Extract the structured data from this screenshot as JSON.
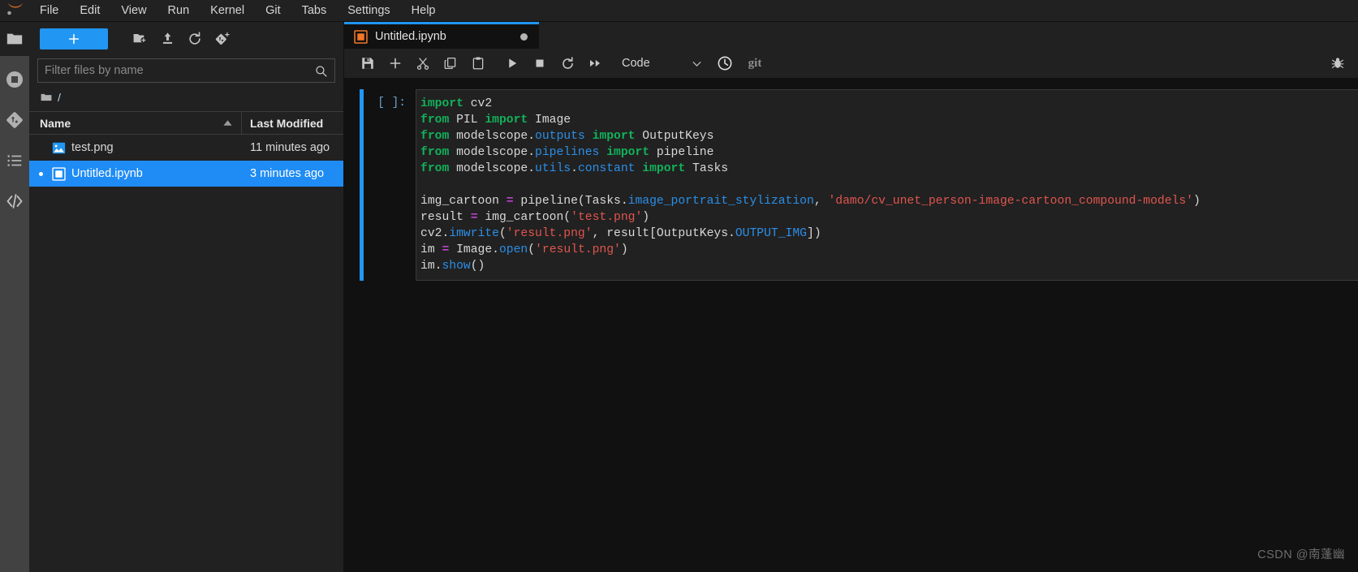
{
  "app": {
    "logo": "jupyter-logo",
    "watermark": "CSDN @南蓬幽"
  },
  "menubar": {
    "items": [
      {
        "label": "File",
        "name": "menu-file"
      },
      {
        "label": "Edit",
        "name": "menu-edit"
      },
      {
        "label": "View",
        "name": "menu-view"
      },
      {
        "label": "Run",
        "name": "menu-run"
      },
      {
        "label": "Kernel",
        "name": "menu-kernel"
      },
      {
        "label": "Git",
        "name": "menu-git"
      },
      {
        "label": "Tabs",
        "name": "menu-tabs"
      },
      {
        "label": "Settings",
        "name": "menu-settings"
      },
      {
        "label": "Help",
        "name": "menu-help"
      }
    ]
  },
  "activitybar": {
    "items": [
      {
        "icon": "folder-icon",
        "name": "sidebar-file-browser",
        "active": true
      },
      {
        "icon": "running-terminals-icon",
        "name": "sidebar-running-sessions",
        "active": false
      },
      {
        "icon": "git-icon",
        "name": "sidebar-git",
        "active": false
      },
      {
        "icon": "table-of-contents-icon",
        "name": "sidebar-table-of-contents",
        "active": false
      },
      {
        "icon": "extension-code-icon",
        "name": "sidebar-extension-manager",
        "active": false
      }
    ]
  },
  "filebrowser": {
    "new_button_label": "+",
    "toolbar": [
      {
        "icon": "new-folder-icon",
        "name": "new-folder-button"
      },
      {
        "icon": "upload-icon",
        "name": "upload-files-button"
      },
      {
        "icon": "refresh-icon",
        "name": "refresh-file-list-button"
      },
      {
        "icon": "new-git-repo-icon",
        "name": "git-clone-button"
      }
    ],
    "filter": {
      "placeholder": "Filter files by name",
      "value": ""
    },
    "breadcrumb": "/",
    "columns": {
      "name": "Name",
      "last_modified": "Last Modified",
      "sort_direction": "ascending"
    },
    "rows": [
      {
        "name": "test.png",
        "last_modified": "11 minutes ago",
        "icon": "image-file-icon",
        "selected": false,
        "running": false
      },
      {
        "name": "Untitled.ipynb",
        "last_modified": "3 minutes ago",
        "icon": "notebook-file-icon",
        "selected": true,
        "running": true
      }
    ]
  },
  "main": {
    "tabs": [
      {
        "label": "Untitled.ipynb",
        "icon": "notebook-icon",
        "dirty": true,
        "active": true
      }
    ],
    "notebook_toolbar": {
      "buttons": [
        {
          "icon": "save-icon",
          "name": "save-notebook-button"
        },
        {
          "icon": "add-cell-icon",
          "name": "insert-cell-button"
        },
        {
          "icon": "cut-icon",
          "name": "cut-cell-button"
        },
        {
          "icon": "copy-icon",
          "name": "copy-cell-button"
        },
        {
          "icon": "paste-icon",
          "name": "paste-cell-button"
        },
        {
          "icon": "run-icon",
          "name": "run-cell-button"
        },
        {
          "icon": "stop-icon",
          "name": "interrupt-kernel-button"
        },
        {
          "icon": "restart-icon",
          "name": "restart-kernel-button"
        },
        {
          "icon": "fast-forward-icon",
          "name": "restart-and-run-all-button"
        }
      ],
      "cell_type": "Code",
      "cell_type_chevron": "chevron-down-icon",
      "history_icon": "clock-icon",
      "git_label": "git",
      "debugger_icon": "bug-icon"
    },
    "cell": {
      "prompt": "[ ]:",
      "lines": [
        [
          {
            "t": "import",
            "c": "kw"
          },
          {
            "t": " cv2",
            "c": "plain"
          }
        ],
        [
          {
            "t": "from",
            "c": "kw"
          },
          {
            "t": " PIL ",
            "c": "plain"
          },
          {
            "t": "import",
            "c": "kw"
          },
          {
            "t": " Image",
            "c": "plain"
          }
        ],
        [
          {
            "t": "from",
            "c": "kw"
          },
          {
            "t": " modelscope.",
            "c": "plain"
          },
          {
            "t": "outputs",
            "c": "mod"
          },
          {
            "t": " ",
            "c": "plain"
          },
          {
            "t": "import",
            "c": "kw"
          },
          {
            "t": " OutputKeys",
            "c": "plain"
          }
        ],
        [
          {
            "t": "from",
            "c": "kw"
          },
          {
            "t": " modelscope.",
            "c": "plain"
          },
          {
            "t": "pipelines",
            "c": "mod"
          },
          {
            "t": " ",
            "c": "plain"
          },
          {
            "t": "import",
            "c": "kw"
          },
          {
            "t": " pipeline",
            "c": "plain"
          }
        ],
        [
          {
            "t": "from",
            "c": "kw"
          },
          {
            "t": " modelscope.",
            "c": "plain"
          },
          {
            "t": "utils",
            "c": "mod"
          },
          {
            "t": ".",
            "c": "plain"
          },
          {
            "t": "constant",
            "c": "mod"
          },
          {
            "t": " ",
            "c": "plain"
          },
          {
            "t": "import",
            "c": "kw"
          },
          {
            "t": " Tasks",
            "c": "plain"
          }
        ],
        [],
        [
          {
            "t": "img_cartoon ",
            "c": "plain"
          },
          {
            "t": "=",
            "c": "op"
          },
          {
            "t": " pipeline(Tasks.",
            "c": "plain"
          },
          {
            "t": "image_portrait_stylization",
            "c": "mod"
          },
          {
            "t": ", ",
            "c": "plain"
          },
          {
            "t": "'damo/cv_unet_person-image-cartoon_compound-models'",
            "c": "str"
          },
          {
            "t": ")",
            "c": "plain"
          }
        ],
        [
          {
            "t": "result ",
            "c": "plain"
          },
          {
            "t": "=",
            "c": "op"
          },
          {
            "t": " img_cartoon(",
            "c": "plain"
          },
          {
            "t": "'test.png'",
            "c": "str"
          },
          {
            "t": ")",
            "c": "plain"
          }
        ],
        [
          {
            "t": "cv2.",
            "c": "plain"
          },
          {
            "t": "imwrite",
            "c": "fn"
          },
          {
            "t": "(",
            "c": "plain"
          },
          {
            "t": "'result.png'",
            "c": "str"
          },
          {
            "t": ", result[OutputKeys.",
            "c": "plain"
          },
          {
            "t": "OUTPUT_IMG",
            "c": "mod"
          },
          {
            "t": "])",
            "c": "plain"
          }
        ],
        [
          {
            "t": "im ",
            "c": "plain"
          },
          {
            "t": "=",
            "c": "op"
          },
          {
            "t": " Image.",
            "c": "plain"
          },
          {
            "t": "open",
            "c": "fn"
          },
          {
            "t": "(",
            "c": "plain"
          },
          {
            "t": "'result.png'",
            "c": "str"
          },
          {
            "t": ")",
            "c": "plain"
          }
        ],
        [
          {
            "t": "im.",
            "c": "plain"
          },
          {
            "t": "show",
            "c": "fn"
          },
          {
            "t": "()",
            "c": "plain"
          }
        ]
      ]
    }
  },
  "colors": {
    "accent": "#2196f3",
    "selection": "#1f8cf5",
    "panel_bg": "#212121",
    "editor_bg": "#212121",
    "body_bg": "#111111",
    "activitybar_bg": "#424242",
    "keyword": "#13b15a",
    "module": "#2b8fe8",
    "string": "#e0554e",
    "operator": "#bb44cc"
  }
}
